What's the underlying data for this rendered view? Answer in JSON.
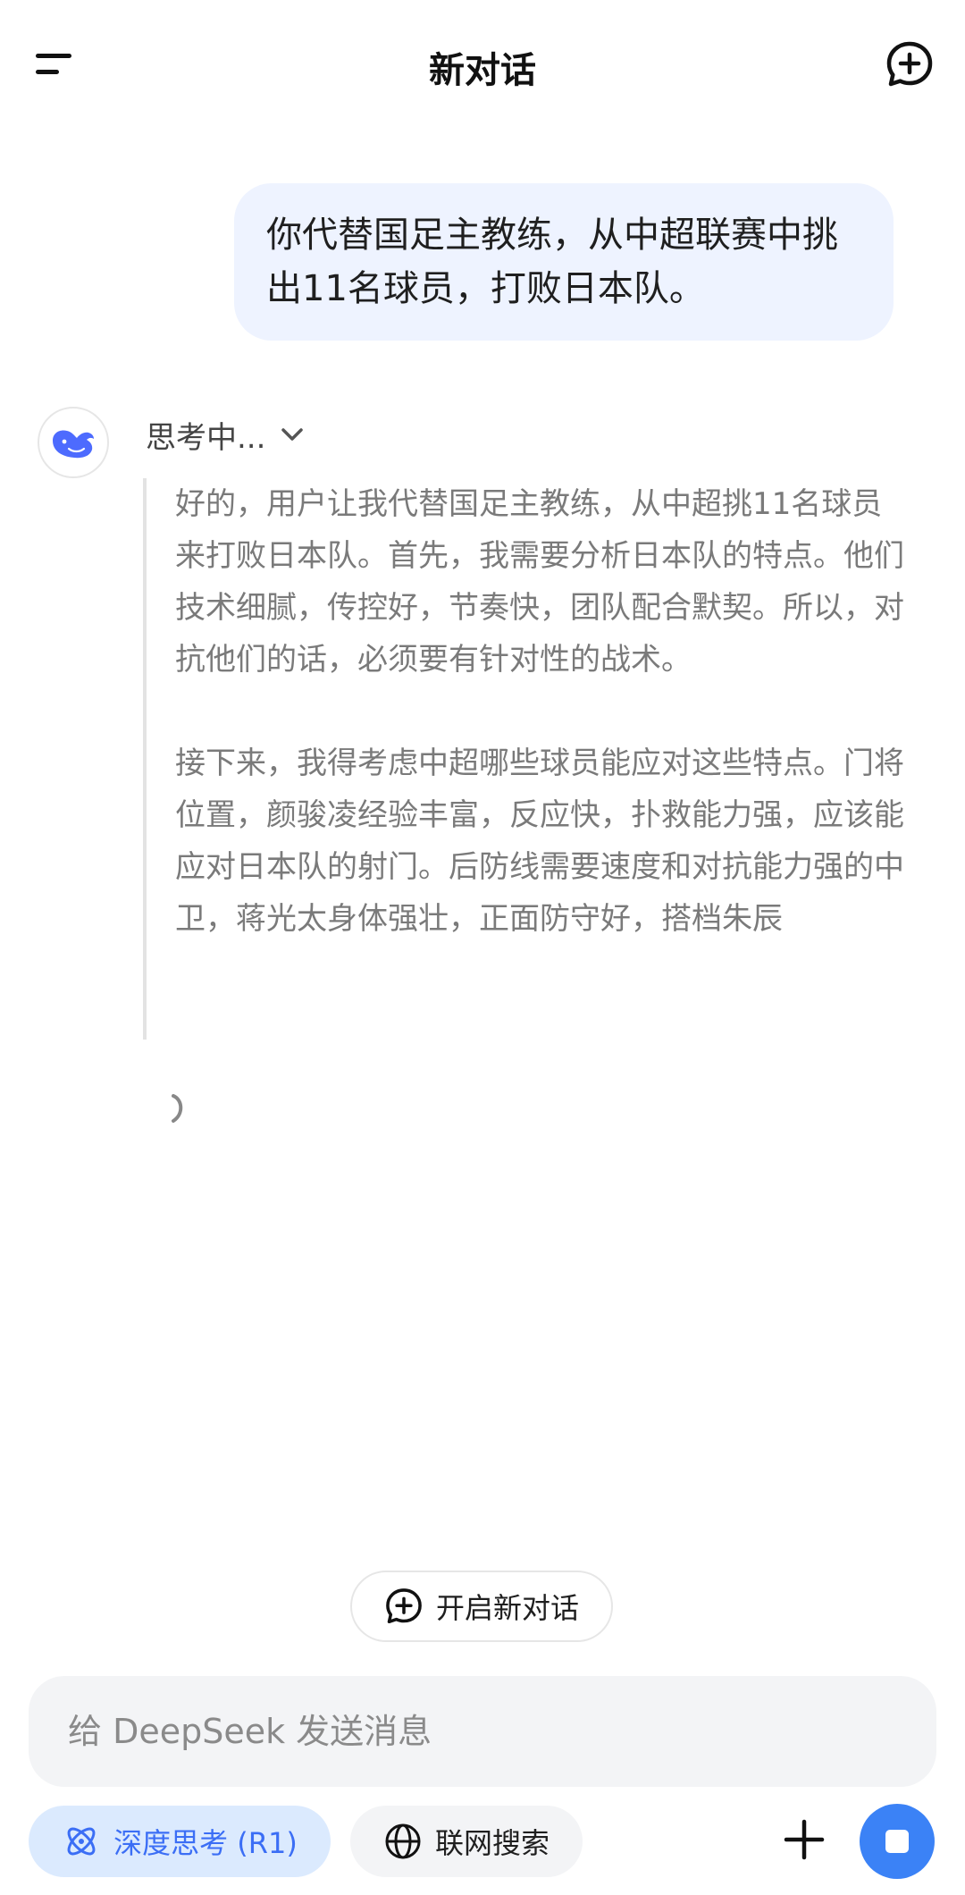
{
  "header": {
    "title": "新对话"
  },
  "conversation": {
    "user_message": "你代替国足主教练，从中超联赛中挑出11名球员，打败日本队。",
    "assistant": {
      "thinking_label": "思考中...",
      "thinking_paragraphs": [
        "好的，用户让我代替国足主教练，从中超挑11名球员来打败日本队。首先，我需要分析日本队的特点。他们技术细腻，传控好，节奏快，团队配合默契。所以，对抗他们的话，必须要有针对性的战术。",
        "接下来，我得考虑中超哪些球员能应对这些特点。门将位置，颜骏凌经验丰富，反应快，扑救能力强，应该能应对日本队的射门。后防线需要速度和对抗能力强的中卫，蒋光太身体强壮，正面防守好，搭档朱辰"
      ]
    }
  },
  "new_chat_pill": {
    "label": "开启新对话"
  },
  "input": {
    "placeholder": "给 DeepSeek 发送消息",
    "value": ""
  },
  "toolbar": {
    "deep_think_label": "深度思考 (R1)",
    "web_search_label": "联网搜索"
  },
  "colors": {
    "accent": "#3b82f6",
    "user_bubble_bg": "#eef3ff",
    "deep_think_bg": "#dbeafe"
  },
  "icons": {
    "menu": "menu-icon",
    "new_chat": "new-chat-icon",
    "avatar": "deepseek-whale-icon",
    "chevron": "chevron-down-icon",
    "spinner": "loading-spinner-icon",
    "deep_think": "atom-icon",
    "web_search": "globe-icon",
    "plus": "plus-icon",
    "stop": "stop-icon"
  }
}
